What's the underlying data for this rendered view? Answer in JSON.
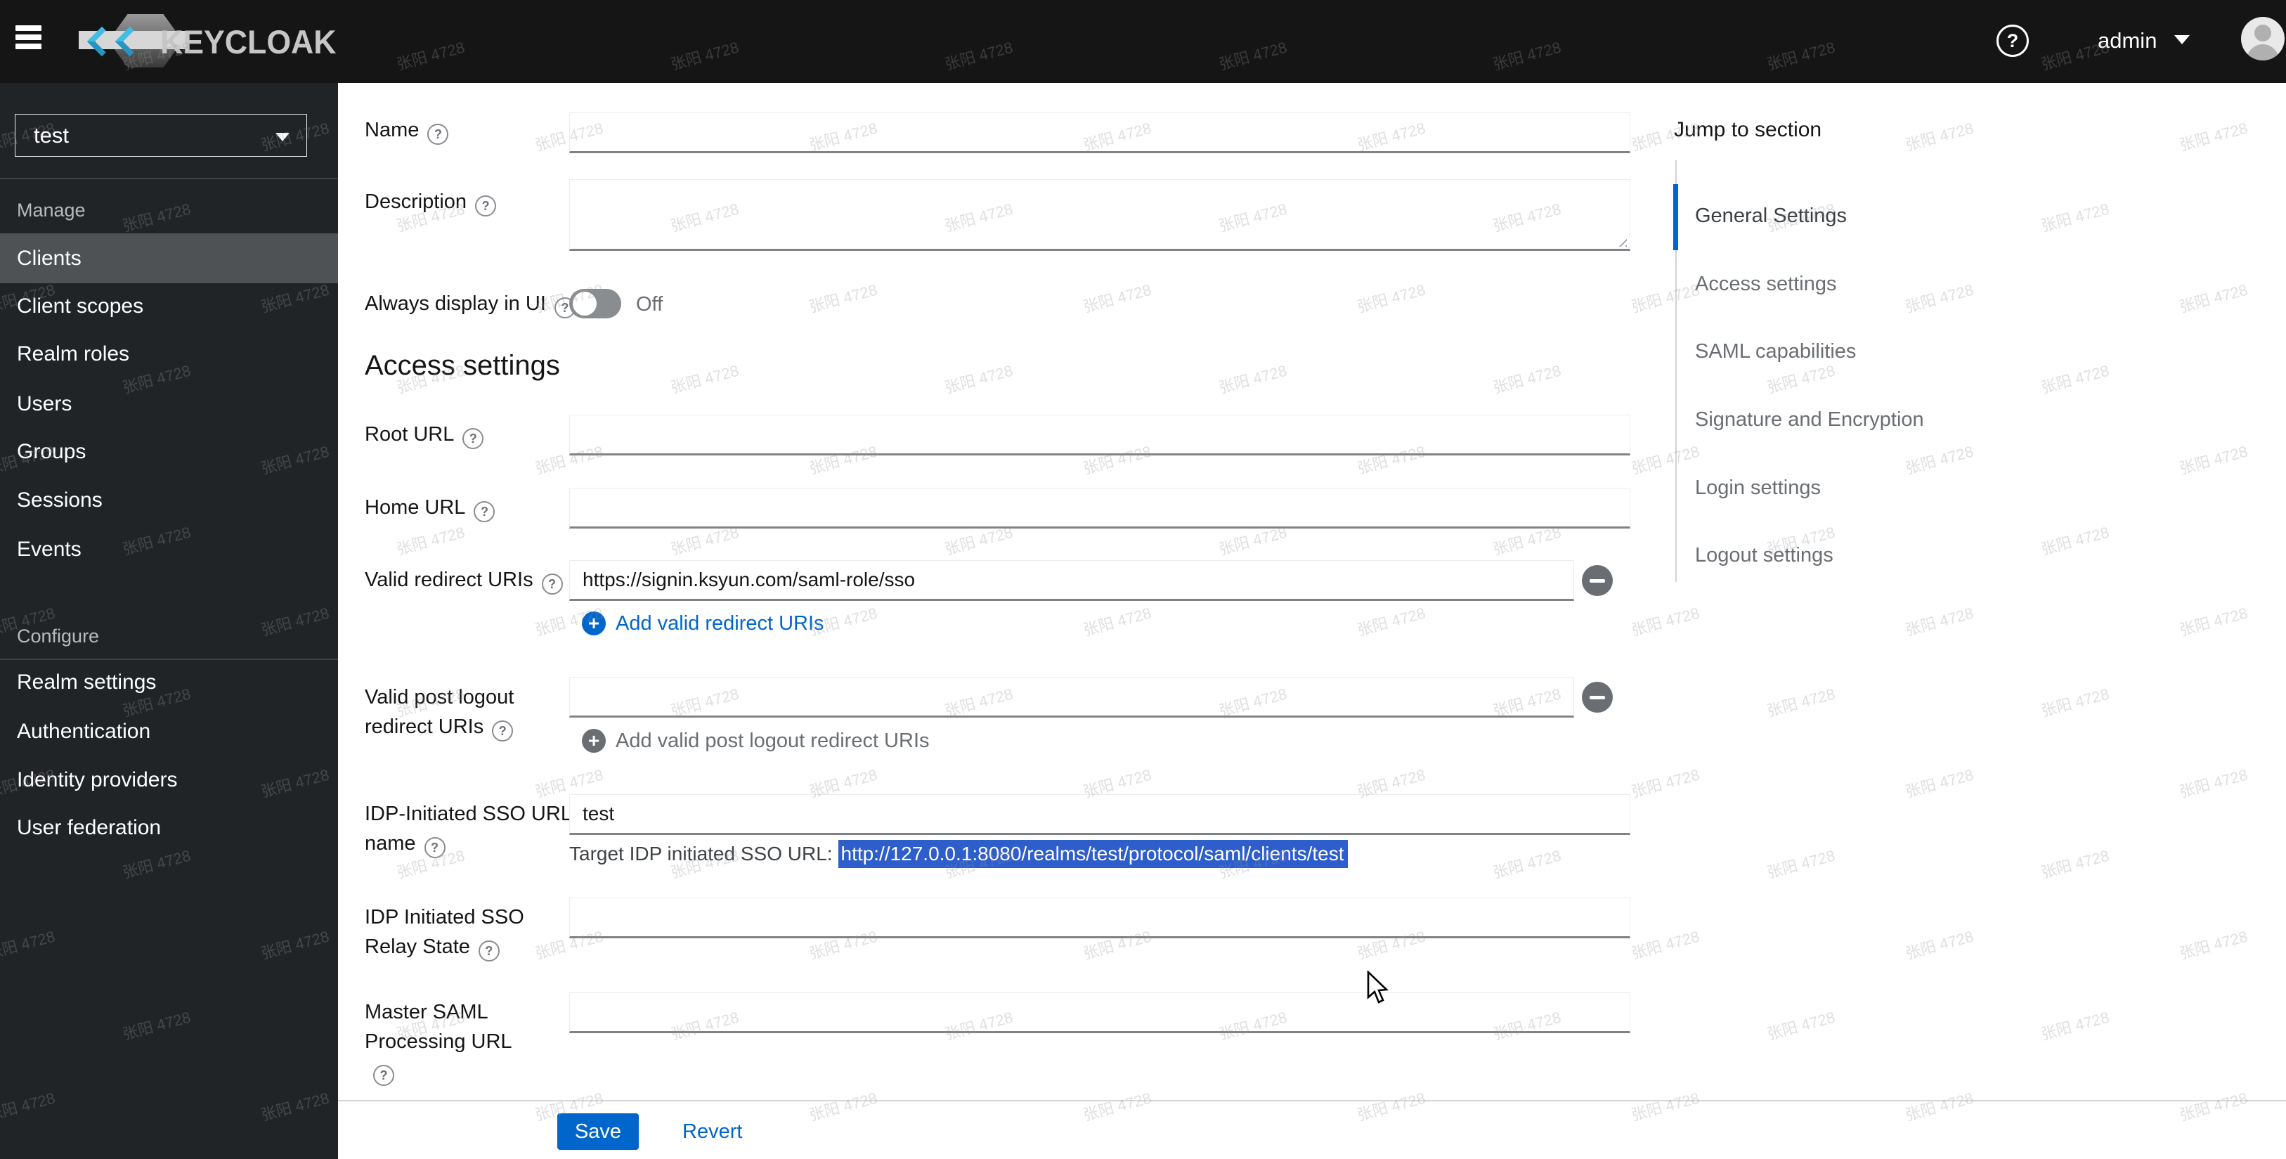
{
  "watermark": {
    "text": "张阳 4728"
  },
  "header": {
    "brand": "KEYCLOAK",
    "username": "admin"
  },
  "sidebar": {
    "realm_selector": {
      "value": "test"
    },
    "groups": [
      {
        "label": "Manage",
        "items": [
          "Clients",
          "Client scopes",
          "Realm roles",
          "Users",
          "Groups",
          "Sessions",
          "Events"
        ]
      },
      {
        "label": "Configure",
        "items": [
          "Realm settings",
          "Authentication",
          "Identity providers",
          "User federation"
        ]
      }
    ]
  },
  "form": {
    "name": {
      "label": "Name",
      "value": ""
    },
    "description": {
      "label": "Description",
      "value": ""
    },
    "always_display": {
      "label": "Always display in UI",
      "state": "Off"
    },
    "access_settings_heading": "Access settings",
    "root_url": {
      "label": "Root URL",
      "value": ""
    },
    "home_url": {
      "label": "Home URL",
      "value": ""
    },
    "valid_redirect": {
      "label": "Valid redirect URIs",
      "value": "https://signin.ksyun.com/saml-role/sso",
      "add_label": "Add valid redirect URIs"
    },
    "post_logout": {
      "label": "Valid post logout redirect URIs",
      "value": "",
      "add_label": "Add valid post logout redirect URIs"
    },
    "idp_sso_name": {
      "label": "IDP-Initiated SSO URL name",
      "value": "test",
      "target_prefix": "Target IDP initiated SSO URL:",
      "target_url": "http://127.0.0.1:8080/realms/test/protocol/saml/clients/test"
    },
    "idp_relay": {
      "label": "IDP Initiated SSO Relay State",
      "value": ""
    },
    "master_saml": {
      "label": "Master SAML Processing URL",
      "value": ""
    }
  },
  "jump": {
    "title": "Jump to section",
    "items": [
      "General Settings",
      "Access settings",
      "SAML capabilities",
      "Signature and Encryption",
      "Login settings",
      "Logout settings"
    ]
  },
  "footer": {
    "save": "Save",
    "revert": "Revert"
  }
}
